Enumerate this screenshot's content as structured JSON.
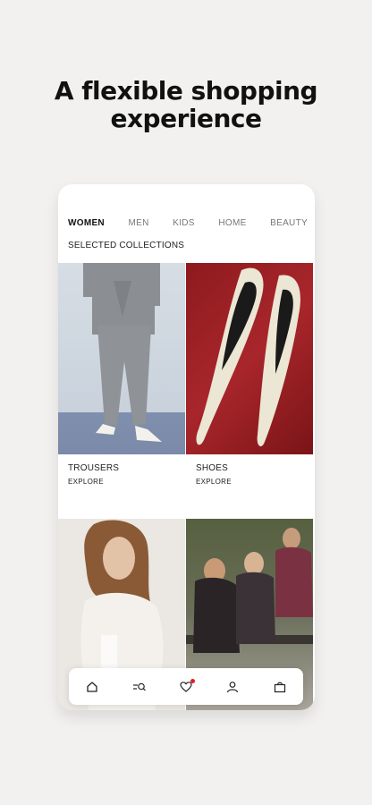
{
  "headline": {
    "line1": "A flexible shopping",
    "line2": "experience"
  },
  "nav": {
    "tabs": [
      {
        "label": "WOMEN",
        "active": true
      },
      {
        "label": "MEN",
        "active": false
      },
      {
        "label": "KIDS",
        "active": false
      },
      {
        "label": "HOME",
        "active": false
      },
      {
        "label": "BEAUTY",
        "active": false
      }
    ]
  },
  "section_title": "SELECTED COLLECTIONS",
  "collections": [
    {
      "name": "TROUSERS",
      "action": "EXPLORE"
    },
    {
      "name": "SHOES",
      "action": "EXPLORE"
    },
    {
      "name": "",
      "action": ""
    },
    {
      "name": "",
      "action": ""
    }
  ],
  "tabbar": {
    "items": [
      "home-icon",
      "search-menu-icon",
      "heart-icon",
      "account-icon",
      "bag-icon"
    ],
    "badge_color": "#e01b24"
  },
  "colors": {
    "background": "#f2f1ef",
    "card": "#ffffff",
    "text": "#111111"
  }
}
